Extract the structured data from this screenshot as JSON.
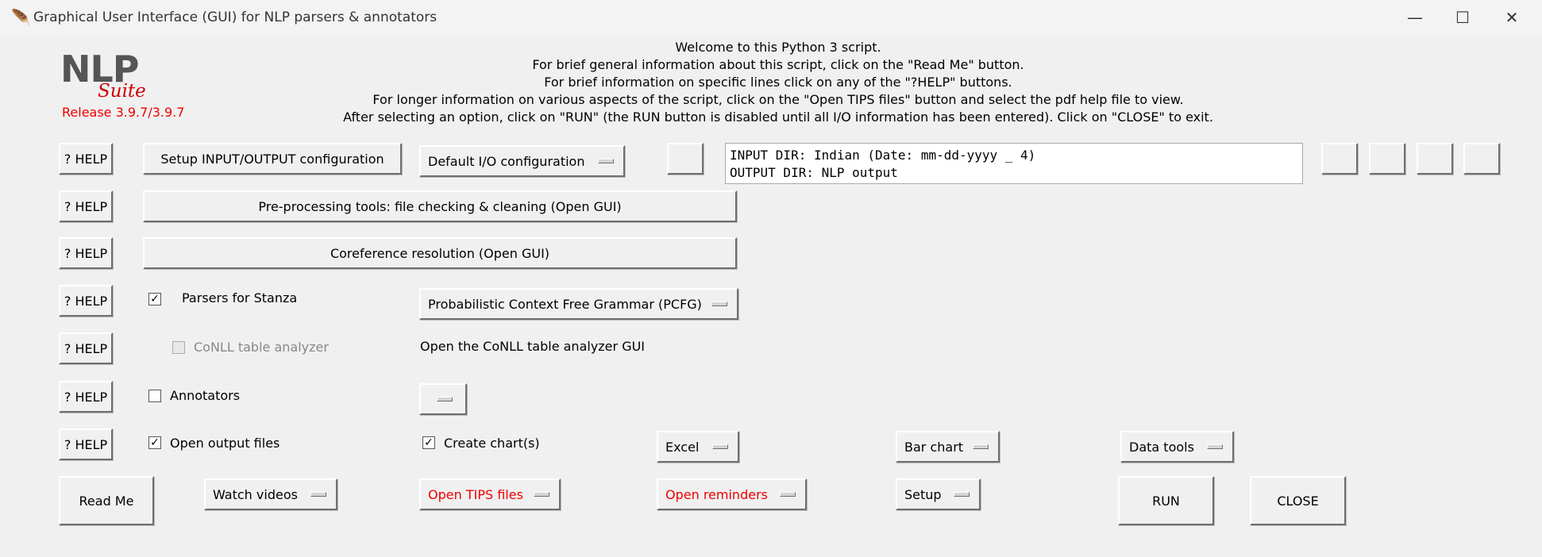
{
  "window": {
    "title": "Graphical User Interface (GUI) for NLP parsers & annotators",
    "minimize": "—",
    "maximize": "☐",
    "close": "✕"
  },
  "logo": {
    "nlp": "NLP",
    "suite": "Suite",
    "release": "Release 3.9.7/3.9.7"
  },
  "welcome": [
    "Welcome to this Python 3 script.",
    "For brief general information about this script, click on the \"Read Me\" button.",
    "For brief information on specific lines click on any of the \"?HELP\" buttons.",
    "For longer information on various aspects of the script, click on the \"Open TIPS files\" button and select the pdf help file to view.",
    "After selecting an option, click on \"RUN\" (the RUN button is disabled until all I/O information has been entered).   Click on \"CLOSE\" to exit."
  ],
  "help_label": "? HELP",
  "io": {
    "setup_button": "Setup INPUT/OUTPUT configuration",
    "config_menu": "Default I/O configuration",
    "input_dir": "INPUT DIR: Indian (Date: mm-dd-yyyy _ 4)",
    "output_dir": "OUTPUT DIR: NLP output"
  },
  "preprocessing_button": "Pre-processing tools: file checking & cleaning (Open GUI)",
  "coreference_button": "Coreference resolution (Open GUI)",
  "parsers": {
    "label": "Parsers for Stanza",
    "checked": true,
    "menu": "Probabilistic Context Free Grammar (PCFG)"
  },
  "conll": {
    "label": "CoNLL table analyzer",
    "checked": false,
    "info": "Open the CoNLL table analyzer GUI"
  },
  "annotators": {
    "label": "Annotators",
    "checked": false
  },
  "output": {
    "open_files_label": "Open output files",
    "open_files_checked": true,
    "create_charts_label": "Create chart(s)",
    "create_charts_checked": true,
    "excel_menu": "Excel",
    "chart_menu": "Bar chart",
    "data_tools_menu": "Data tools"
  },
  "bottom": {
    "read_me": "Read Me",
    "watch_videos": "Watch videos",
    "open_tips": "Open TIPS files",
    "open_reminders": "Open reminders",
    "setup": "Setup",
    "run": "RUN",
    "close": "CLOSE"
  },
  "check_mark": "✓"
}
